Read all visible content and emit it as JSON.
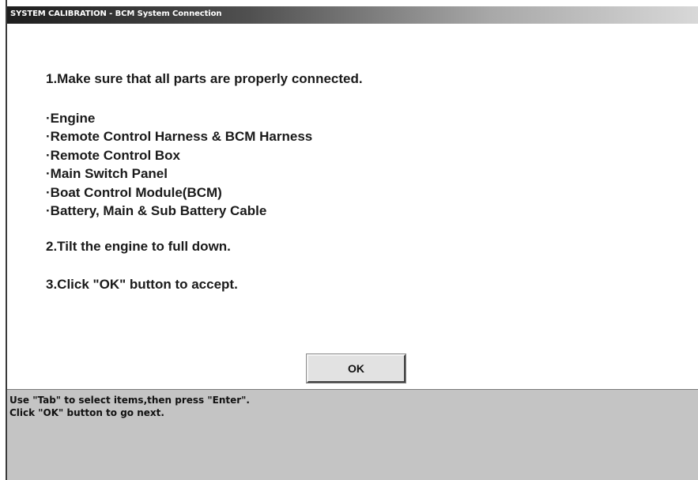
{
  "window": {
    "title": "SYSTEM CALIBRATION - BCM System Connection"
  },
  "instructions": {
    "step1": "1.Make sure that all parts are properly connected.",
    "parts": [
      "·Engine",
      "·Remote Control Harness & BCM Harness",
      "·Remote Control Box",
      "·Main Switch Panel",
      "·Boat Control Module(BCM)",
      "·Battery, Main & Sub Battery Cable"
    ],
    "step2": "2.Tilt the engine to full down.",
    "step3": "3.Click \"OK\" button to accept."
  },
  "buttons": {
    "ok_label": "OK"
  },
  "status": {
    "line1": "Use \"Tab\" to select items,then press \"Enter\".",
    "line2": "Click \"OK\" button to go next."
  },
  "colors": {
    "title_bar_dark": "#1e1e1e",
    "title_bar_light": "#d8d8d8",
    "content_bg": "#ffffff",
    "status_bg": "#c4c4c4",
    "button_face": "#e2e2e2"
  }
}
